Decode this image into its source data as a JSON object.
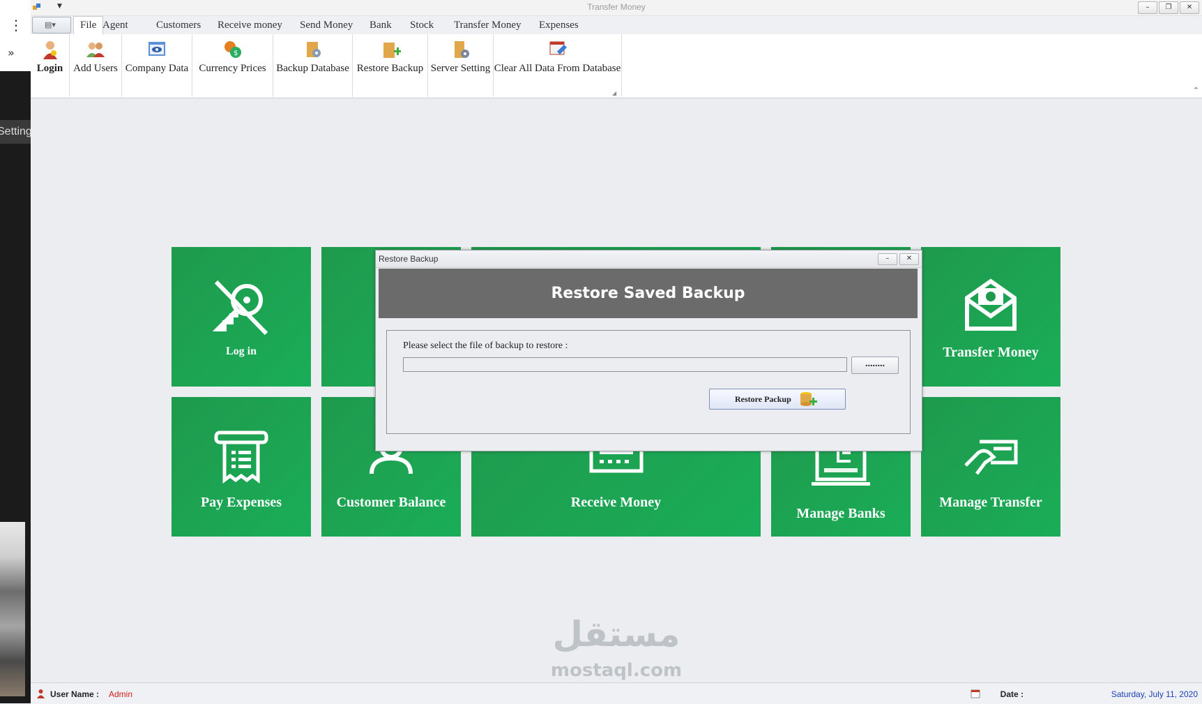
{
  "window": {
    "title": "Transfer Money"
  },
  "left_panel": {
    "settings_label": "Settings"
  },
  "tabs": [
    "File",
    "Agent",
    "Customers",
    "Receive money",
    "Send Money",
    "Bank",
    "Stock",
    "Transfer Money",
    "Expenses"
  ],
  "active_tab": "File",
  "ribbon": [
    {
      "label": "Login",
      "icon": "login-icon"
    },
    {
      "label": "Add Users",
      "icon": "users-icon"
    },
    {
      "label": "Company Data",
      "icon": "company-data-icon"
    },
    {
      "label": "Currency Prices",
      "icon": "currency-icon"
    },
    {
      "label": "Backup Database",
      "icon": "backup-database-icon"
    },
    {
      "label": "Restore Backup",
      "icon": "restore-backup-icon"
    },
    {
      "label": "Server Setting",
      "icon": "server-setting-icon"
    },
    {
      "label": "Clear All Data From Database",
      "icon": "clear-data-icon"
    }
  ],
  "tiles": {
    "login": "Log in",
    "transfer_money": "Transfer Money",
    "pay_expenses": "Pay Expenses",
    "customer_balance": "Customer Balance",
    "receive_money": "Receive Money",
    "manage_banks": "Manage Banks",
    "manage_transfer": "Manage Transfer"
  },
  "dialog": {
    "title": "Restore Backup",
    "header": "Restore Saved Backup",
    "prompt": "Please select the file of backup to restore :",
    "path_value": "",
    "browse_label": "........",
    "restore_label": "Restore Packup"
  },
  "status": {
    "user_label": "User Name :",
    "user_value": "Admin",
    "date_label": "Date :",
    "date_value": "Saturday, July 11, 2020"
  },
  "watermark": {
    "arabic": "مستقل",
    "latin": "mostaql.com"
  },
  "colors": {
    "tile_green": "#1aa557",
    "dialog_header": "#6b6b6b",
    "user_value": "#d02020",
    "date_value": "#1a3fb8"
  }
}
